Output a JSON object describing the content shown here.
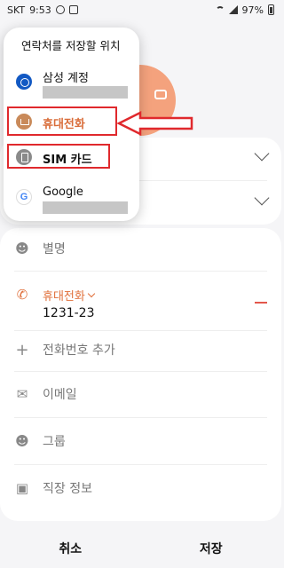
{
  "status_bar": {
    "carrier": "SKT",
    "time": "9:53",
    "battery": "97%"
  },
  "popup": {
    "title": "연락처를 저장할 위치",
    "options": [
      {
        "label": "삼성 계정",
        "icon": "samsung-account-icon"
      },
      {
        "label": "휴대전화",
        "icon": "phone-storage-icon"
      },
      {
        "label": "SIM 카드",
        "icon": "sim-card-icon"
      },
      {
        "label": "Google",
        "icon": "google-icon"
      }
    ]
  },
  "form": {
    "field2_suffix": ")",
    "nickname_label": "별명",
    "phone_type": "휴대전화",
    "phone_number": "1231-23",
    "add_phone_label": "전화번호 추가",
    "email_label": "이메일",
    "group_label": "그룹",
    "work_label": "직장 정보"
  },
  "bottom_bar": {
    "cancel": "취소",
    "save": "저장"
  },
  "colors": {
    "accent": "#e0703b",
    "highlight": "#e0292d",
    "samsung": "#1259c3"
  }
}
